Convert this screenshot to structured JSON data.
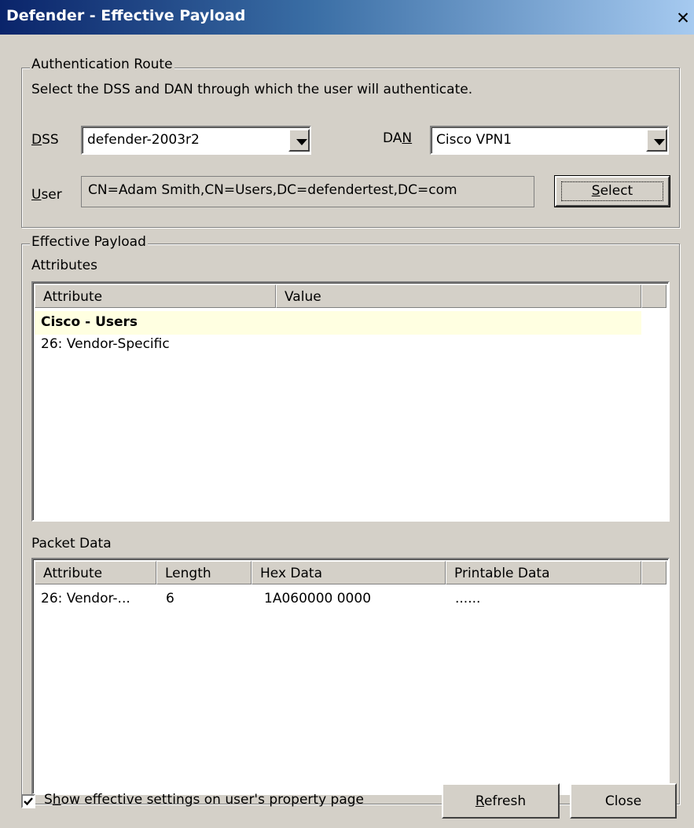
{
  "window": {
    "title": "Defender - Effective Payload",
    "close_glyph": "✕"
  },
  "auth_route": {
    "legend": "Authentication Route",
    "description": "Select the DSS and DAN through which the user will authenticate.",
    "dss_label_prefix": "D",
    "dss_label_rest": "SS",
    "dss_value": "defender-2003r2",
    "dan_label_prefix": "DA",
    "dan_label_ul": "N",
    "dan_value": "Cisco VPN1",
    "user_label_ul": "U",
    "user_label_rest": "ser",
    "user_value": "CN=Adam Smith,CN=Users,DC=defendertest,DC=com",
    "select_button_ul": "S",
    "select_button_rest": "elect"
  },
  "payload": {
    "legend": "Effective Payload",
    "attributes_label": "Attributes",
    "attr_columns": [
      "Attribute",
      "Value"
    ],
    "attr_group": "Cisco - Users",
    "attr_rows": [
      {
        "attribute": "26: Vendor-Specific",
        "value": ""
      }
    ],
    "packet_label": "Packet Data",
    "packet_columns": [
      "Attribute",
      "Length",
      "Hex Data",
      "Printable Data"
    ],
    "packet_rows": [
      {
        "attribute": "26: Vendor-...",
        "length": "6",
        "hex": "1A060000 0000",
        "printable": "......"
      }
    ]
  },
  "footer": {
    "checkbox_checked": true,
    "checkbox_label_pre": "S",
    "checkbox_label_ul": "h",
    "checkbox_label_rest": "ow effective settings on user's property page",
    "refresh_ul": "R",
    "refresh_rest": "efresh",
    "close_label": "Close"
  },
  "colors": {
    "title_gradient_start": "#0a246a",
    "title_gradient_end": "#a6caf0",
    "dialog_bg": "#d4d0c8",
    "group_row_highlight": "#ffffe1"
  }
}
